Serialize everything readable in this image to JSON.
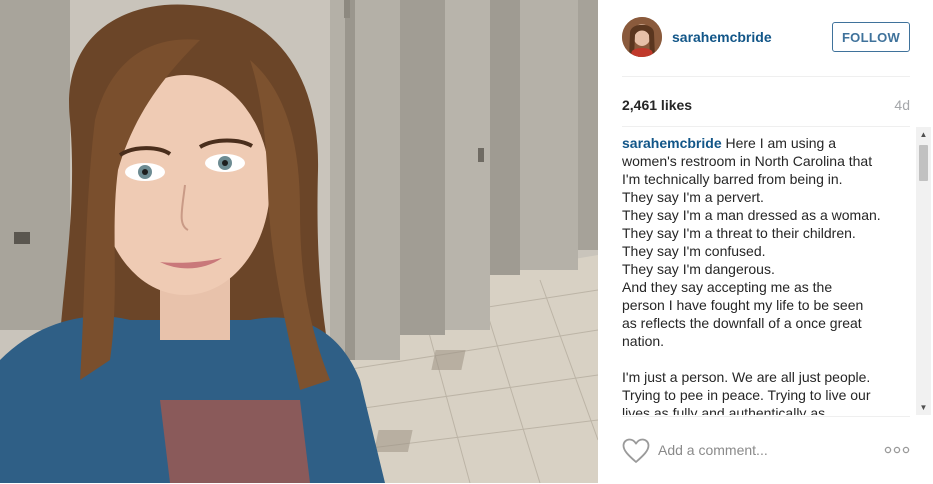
{
  "post": {
    "photo_alt": "photo-selfie-in-restroom",
    "user": {
      "username": "sarahemcbride",
      "follow_label": "FOLLOW"
    },
    "likes": "2,461 likes",
    "posted_ago": "4d",
    "caption": {
      "username": "sarahemcbride",
      "lines": [
        " Here I am using a",
        "women's restroom in North Carolina that",
        "I'm technically barred from being in.",
        "They say I'm a pervert.",
        "They say I'm a man dressed as a woman.",
        "They say I'm a threat to their children.",
        "They say I'm confused.",
        "They say I'm dangerous.",
        "And they say accepting me as the",
        "person I have fought my life to be seen",
        "as reflects the downfall of a once great",
        "nation.",
        "",
        "I'm just a person. We are all just people.",
        "Trying to pee in peace. Trying to live our",
        "lives as fully and authentically as"
      ]
    },
    "comment": {
      "placeholder": "Add a comment..."
    },
    "icons": {
      "like": "heart-icon",
      "more": "more-options-icon",
      "scroll_up": "scroll-up-arrow-icon",
      "scroll_down": "scroll-down-arrow-icon"
    },
    "colors": {
      "link": "#125688",
      "follow": "#3f729b",
      "text": "#262626",
      "muted": "#a5a7aa"
    }
  }
}
